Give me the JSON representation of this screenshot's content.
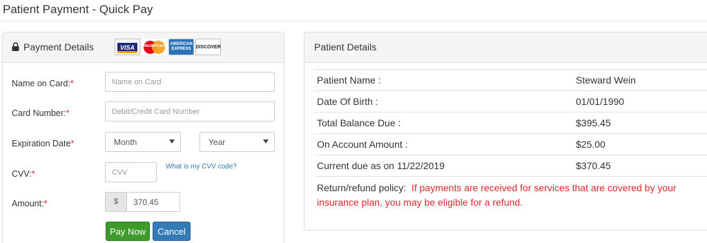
{
  "page": {
    "title": "Patient Payment - Quick Pay"
  },
  "payment": {
    "heading": "Payment Details",
    "cards": [
      {
        "name": "VISA",
        "icon": "visa-card-icon"
      },
      {
        "name": "MasterCard",
        "icon": "mastercard-icon"
      },
      {
        "name": "AMERICAN EXPRESS",
        "icon": "amex-card-icon"
      },
      {
        "name": "DISCOVER",
        "icon": "discover-card-icon"
      }
    ],
    "name_label": "Name on Card:",
    "name_placeholder": "Name on Card",
    "card_label": "Card Number:",
    "card_placeholder": "Debit/Credit Card Number",
    "exp_label": "Expiration Date",
    "month_value": "Month",
    "year_value": "Year",
    "cvv_label": "CVV:",
    "cvv_placeholder": "CVV",
    "cvv_help": "What is my CVV code?",
    "amount_label": "Amount:",
    "currency": "$",
    "amount_value": "370.45",
    "pay_label": "Pay Now",
    "cancel_label": "Cancel",
    "required_mark": "*"
  },
  "patient": {
    "heading": "Patient Details",
    "rows": [
      {
        "label": "Patient Name :",
        "value": "Steward Wein"
      },
      {
        "label": "Date Of Birth :",
        "value": "01/01/1990"
      },
      {
        "label": "Total Balance Due :",
        "value": "$395.45"
      },
      {
        "label": "On Account Amount :",
        "value": "$25.00"
      },
      {
        "label": "Current due as on 11/22/2019",
        "value": "$370.45"
      }
    ],
    "policy_label": "Return/refund policy:",
    "policy_text": "If payments are received for services that are covered by your insurance plan, you may be eligible for a refund."
  },
  "colors": {
    "required": "#e0242b",
    "pay_button": "#3d9a2b",
    "cancel_button": "#337ab7",
    "link": "#2a7ab8"
  }
}
